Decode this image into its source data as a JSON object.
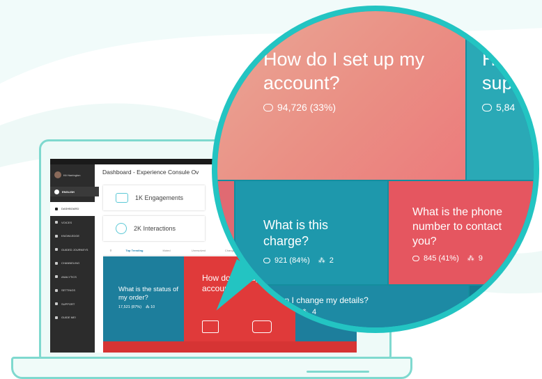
{
  "sidebar": {
    "user_name": "Kit Harrington",
    "language": "ENGLISH",
    "items": [
      {
        "label": "DASHBOARD",
        "icon": "home-icon",
        "active": true
      },
      {
        "label": "VOICES",
        "icon": "megaphone-icon",
        "active": false
      },
      {
        "label": "KNOWLEDGE",
        "icon": "book-icon",
        "active": false
      },
      {
        "label": "GUIDED JOURNEYS",
        "icon": "pin-icon",
        "active": false
      },
      {
        "label": "CHANNELING",
        "icon": "branch-icon",
        "active": false
      },
      {
        "label": "ANALYTICS",
        "icon": "chart-icon",
        "active": false
      },
      {
        "label": "SETTINGS",
        "icon": "gear-icon",
        "active": false
      },
      {
        "label": "SUPPORT",
        "icon": "help-icon",
        "active": false
      },
      {
        "label": "GUIDE ME!",
        "icon": "compass-icon",
        "active": false
      }
    ]
  },
  "header": {
    "title": "Dashboard - Experience Consule Ov"
  },
  "stats": {
    "engagements": "1K Engagements",
    "interactions": "2K Interactions"
  },
  "tabs": [
    "Top Trending",
    "Muted",
    "Unresolved",
    "Changed"
  ],
  "tiles": {
    "order_status": {
      "question": "What is the status of my order?",
      "count": "17,521 (87%)",
      "people": "10"
    },
    "setup_small": {
      "question": "How do I set up my account?"
    }
  },
  "zoom": {
    "setup": {
      "question": "How do I set up my account?",
      "count": "94,726 (33%)"
    },
    "support": {
      "question_partial": "H\nsup",
      "count_partial": "5,84"
    },
    "charge": {
      "question": "What is this charge?",
      "count": "921 (84%)",
      "people": "2"
    },
    "phone": {
      "question": "What is the phone number to contact you?",
      "count": "845 (41%)",
      "people": "9"
    },
    "details": {
      "question": "an I change my details?",
      "people": "4"
    }
  },
  "colors": {
    "teal": "#1d9fb0",
    "red": "#e03a3a",
    "ring": "#23c4c2",
    "laptop": "#7fd9cf"
  }
}
